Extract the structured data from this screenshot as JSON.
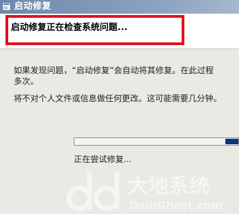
{
  "window": {
    "title": "启动修复"
  },
  "header": {
    "text": "启动修复正在检查系统问题..."
  },
  "body": {
    "line1": "如果发现问题，“启动修复”会自动将其修复。在此过程",
    "line2": "多次。",
    "line3": "将不对个人文件或信息做任何更改。这可能需要几分钟。"
  },
  "progress": {
    "value": 0.08,
    "status_text": "正在尝试修复..."
  },
  "watermark": {
    "brand_cn": "大地系统",
    "brand_en": "DadiGhost.com"
  },
  "colors": {
    "highlight": "#e0101e",
    "progress_fill": "#10337d",
    "titlebar": "#6d88ad"
  }
}
